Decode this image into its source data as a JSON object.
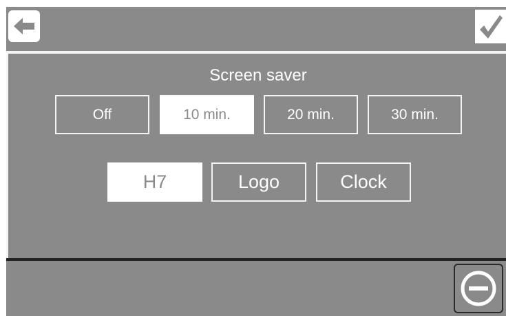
{
  "header": {
    "back_icon": "arrow-left-icon",
    "ok_icon": "checkmark-icon"
  },
  "settings": {
    "title": "Screen saver",
    "timeouts": [
      {
        "label": "Off",
        "selected": false
      },
      {
        "label": "10 min.",
        "selected": true
      },
      {
        "label": "20 min.",
        "selected": false
      },
      {
        "label": "30 min.",
        "selected": false
      }
    ],
    "modes": [
      {
        "label": "H7",
        "selected": true
      },
      {
        "label": "Logo",
        "selected": false
      },
      {
        "label": "Clock",
        "selected": false
      }
    ]
  },
  "footer": {
    "cancel_icon": "minus-circle-icon"
  },
  "colors": {
    "panel": "#8a8a8a",
    "foreground": "#ffffff",
    "divider": "#222222"
  }
}
